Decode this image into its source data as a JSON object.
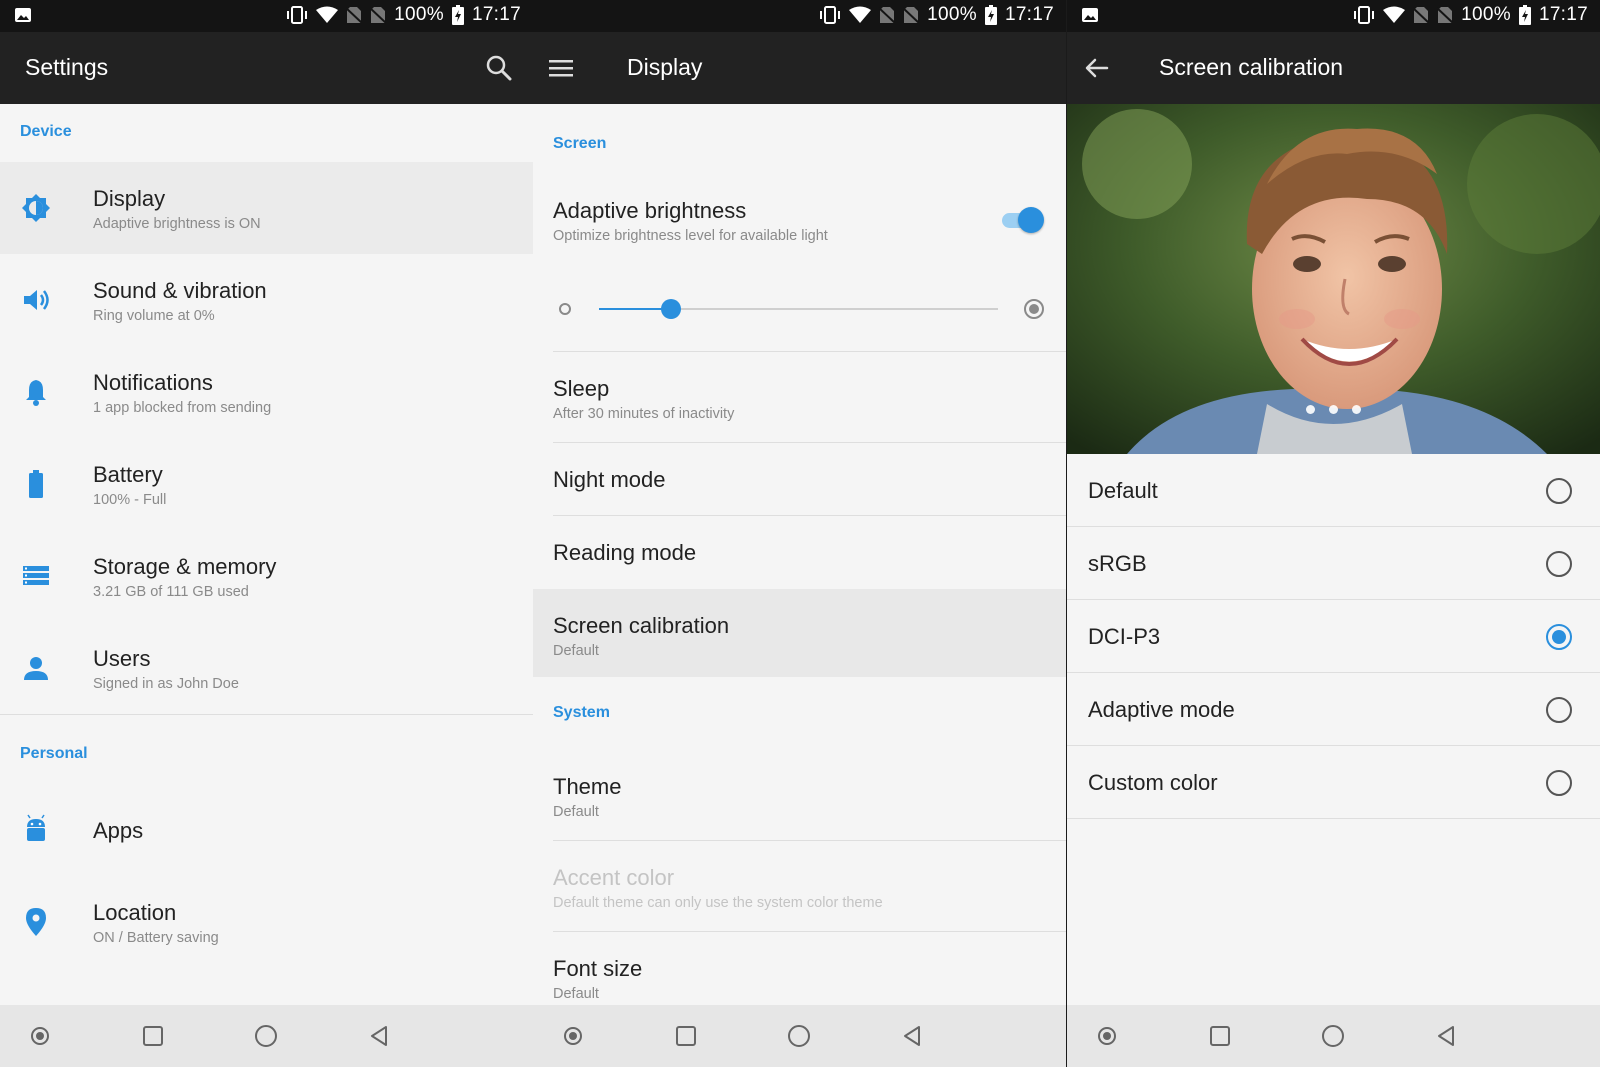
{
  "status": {
    "battery_pct": "100%",
    "time": "17:17"
  },
  "colors": {
    "accent": "#2a8fdd",
    "appbar": "#222222",
    "statusbar": "#141414",
    "background": "#f5f5f5"
  },
  "settings": {
    "title": "Settings",
    "section_device": "Device",
    "section_personal": "Personal",
    "items": [
      {
        "icon": "display-icon",
        "title": "Display",
        "sub": "Adaptive brightness is ON"
      },
      {
        "icon": "speaker-icon",
        "title": "Sound & vibration",
        "sub": "Ring volume at 0%"
      },
      {
        "icon": "bell-icon",
        "title": "Notifications",
        "sub": "1 app blocked from sending"
      },
      {
        "icon": "battery-icon",
        "title": "Battery",
        "sub": "100% - Full"
      },
      {
        "icon": "storage-icon",
        "title": "Storage & memory",
        "sub": "3.21 GB of 111 GB used"
      },
      {
        "icon": "user-icon",
        "title": "Users",
        "sub": "Signed in as John Doe"
      },
      {
        "icon": "android-icon",
        "title": "Apps",
        "sub": ""
      },
      {
        "icon": "location-icon",
        "title": "Location",
        "sub": "ON / Battery saving"
      }
    ]
  },
  "display": {
    "title": "Display",
    "section_screen": "Screen",
    "section_system": "System",
    "adaptive": {
      "title": "Adaptive brightness",
      "sub": "Optimize brightness level for available light",
      "enabled": true
    },
    "brightness_level": 0.18,
    "sleep": {
      "title": "Sleep",
      "sub": "After 30 minutes of inactivity"
    },
    "night_mode": {
      "title": "Night mode"
    },
    "reading_mode": {
      "title": "Reading mode"
    },
    "screen_calibration": {
      "title": "Screen calibration",
      "sub": "Default"
    },
    "theme": {
      "title": "Theme",
      "sub": "Default"
    },
    "accent_color": {
      "title": "Accent color",
      "sub": "Default theme can only use the system color theme"
    },
    "font_size": {
      "title": "Font size",
      "sub": "Default"
    }
  },
  "calibration": {
    "title": "Screen calibration",
    "options": [
      "Default",
      "sRGB",
      "DCI-P3",
      "Adaptive mode",
      "Custom color"
    ],
    "selected": "DCI-P3",
    "selected_index": 2
  }
}
